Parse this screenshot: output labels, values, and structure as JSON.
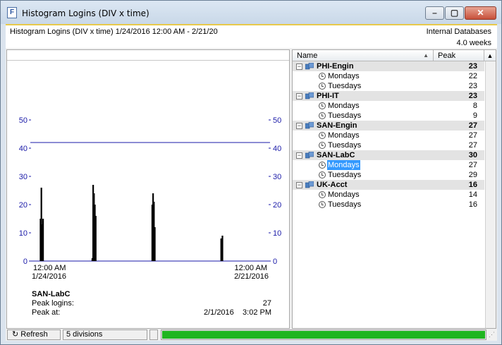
{
  "window": {
    "title": "Histogram Logins (DIV x time)"
  },
  "infobar": {
    "description": "Histogram Logins (DIV x time)  1/24/2016 12:00 AM - 2/21/20",
    "source": "Internal Databases",
    "span": "4.0 weeks"
  },
  "chart_data": {
    "type": "bar",
    "title": "",
    "xlabel": "",
    "ylabel": "",
    "ylim": [
      0,
      50
    ],
    "yticks": [
      "0",
      "10",
      "20",
      "30",
      "40",
      "50"
    ],
    "reference_line": 42,
    "x_start_label": [
      "12:00 AM",
      "1/24/2016"
    ],
    "x_end_label": [
      "12:00 AM",
      "2/21/2016"
    ],
    "x_range_days": [
      0,
      28
    ],
    "bars": [
      {
        "day": 1.1,
        "value": 15
      },
      {
        "day": 1.2,
        "value": 26
      },
      {
        "day": 1.3,
        "value": 13
      },
      {
        "day": 1.4,
        "value": 15
      },
      {
        "day": 7.15,
        "value": 1
      },
      {
        "day": 7.25,
        "value": 27
      },
      {
        "day": 7.35,
        "value": 24
      },
      {
        "day": 7.45,
        "value": 20
      },
      {
        "day": 7.55,
        "value": 16
      },
      {
        "day": 14.15,
        "value": 20
      },
      {
        "day": 14.25,
        "value": 24
      },
      {
        "day": 14.35,
        "value": 21
      },
      {
        "day": 14.45,
        "value": 12
      },
      {
        "day": 22.2,
        "value": 8
      },
      {
        "day": 22.35,
        "value": 9
      }
    ]
  },
  "selection": {
    "name": "SAN-LabC",
    "peak_label": "Peak logins:",
    "peak_value": "27",
    "at_label": "Peak at:",
    "at_date": "2/1/2016",
    "at_time": "3:02 PM"
  },
  "list": {
    "col_name": "Name",
    "col_peak": "Peak",
    "groups": [
      {
        "name": "PHI-Engin",
        "peak": "23",
        "children": [
          {
            "name": "Mondays",
            "peak": "22"
          },
          {
            "name": "Tuesdays",
            "peak": "23"
          }
        ]
      },
      {
        "name": "PHI-IT",
        "peak": "23",
        "children": [
          {
            "name": "Mondays",
            "peak": "8"
          },
          {
            "name": "Tuesdays",
            "peak": "9"
          }
        ]
      },
      {
        "name": "SAN-Engin",
        "peak": "27",
        "children": [
          {
            "name": "Mondays",
            "peak": "27"
          },
          {
            "name": "Tuesdays",
            "peak": "27"
          }
        ]
      },
      {
        "name": "SAN-LabC",
        "peak": "30",
        "children": [
          {
            "name": "Mondays",
            "peak": "27",
            "selected": true
          },
          {
            "name": "Tuesdays",
            "peak": "29"
          }
        ]
      },
      {
        "name": "UK-Acct",
        "peak": "16",
        "children": [
          {
            "name": "Mondays",
            "peak": "14"
          },
          {
            "name": "Tuesdays",
            "peak": "16"
          }
        ]
      }
    ]
  },
  "statusbar": {
    "refresh": "Refresh",
    "divisions": "5 divisions",
    "progress": 1.0,
    "progress_color": "#1fb51f"
  }
}
